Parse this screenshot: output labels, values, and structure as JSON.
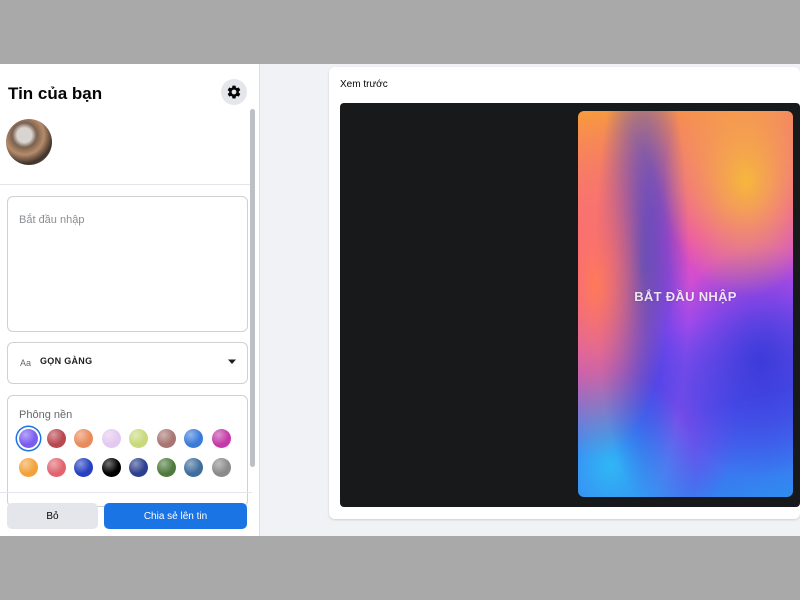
{
  "panel": {
    "title": "Tin của bạn",
    "icons": {
      "settings": "gear-icon",
      "avatar": "profile-avatar",
      "dropdown": "caret-down-icon"
    },
    "text_input": {
      "placeholder": "Bắt đầu nhập",
      "value": ""
    },
    "font_select": {
      "prefix": "Aa",
      "selected": "GỌN GÀNG"
    },
    "background": {
      "title": "Phông nền",
      "selected_index": 0,
      "swatches": [
        "#7a5cf0",
        "#b8474e",
        "#e88b5a",
        "#e3c9ef",
        "#c7d97a",
        "#a77572",
        "#3a7bd9",
        "#c33aa8",
        "#f2a23a",
        "#e0646e",
        "#2540c0",
        "#000000",
        "#2c3f8f",
        "#4f7a3e",
        "#3f6d9c",
        "#8a8a8a"
      ]
    },
    "buttons": {
      "discard": "Bỏ",
      "share": "Chia sẻ lên tin"
    }
  },
  "preview": {
    "label": "Xem trước",
    "card_text": "BẮT ĐẦU NHẬP"
  },
  "colors": {
    "accent": "#1b74e4",
    "stage_background": "#18191a"
  }
}
